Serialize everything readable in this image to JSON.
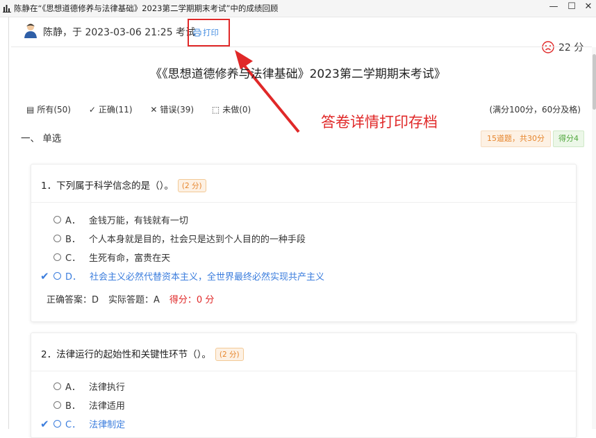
{
  "window": {
    "title": "陈静在“《思想道德修养与法律基础》2023第二学期期末考试”中的成绩回顾",
    "minimize": "—",
    "maximize": "☐",
    "close": "✕"
  },
  "header": {
    "user_line": "陈静，于 2023-03-06 21:25 考试",
    "print_label": "打印",
    "total_score": "22 分"
  },
  "exam_title": "《《思想道德修养与法律基础》2023第二学期期末考试》",
  "filters": [
    {
      "label": "所有(50)",
      "icon": "list-icon"
    },
    {
      "label": "正确(11)",
      "icon": "check-icon"
    },
    {
      "label": "错误(39)",
      "icon": "cross-icon"
    },
    {
      "label": "未做(0)",
      "icon": "empty-box-icon"
    }
  ],
  "rule": "(满分100分，60分及格)",
  "annotation": "答卷详情打印存档",
  "section": {
    "title": "一、 单选",
    "count_badge": "15道题，共30分",
    "score_badge": "得分4"
  },
  "questions": [
    {
      "title": "1．下列属于科学信念的是（）。",
      "points": "(2 分)",
      "options": [
        {
          "letter": "A．",
          "text": "金钱万能，有钱就有一切"
        },
        {
          "letter": "B．",
          "text": "个人本身就是目的，社会只是达到个人目的的一种手段"
        },
        {
          "letter": "C．",
          "text": "生死有命，富贵在天"
        },
        {
          "letter": "D．",
          "text": "社会主义必然代替资本主义，全世界最终必然实现共产主义"
        }
      ],
      "correct_answer": "正确答案：D",
      "actual_answer": "实际答题：A",
      "got": "得分：0 分"
    },
    {
      "title": "2．法律运行的起始性和关键性环节（）。",
      "points": "(2 分)",
      "options": [
        {
          "letter": "A．",
          "text": "法律执行"
        },
        {
          "letter": "B．",
          "text": "法律适用"
        },
        {
          "letter": "C．",
          "text": "法律制定"
        }
      ]
    }
  ],
  "colors": {
    "accent_blue": "#3b7ddd",
    "annotation_red": "#e02828",
    "badge_orange": "#e6852c",
    "badge_green": "#52a83f"
  }
}
